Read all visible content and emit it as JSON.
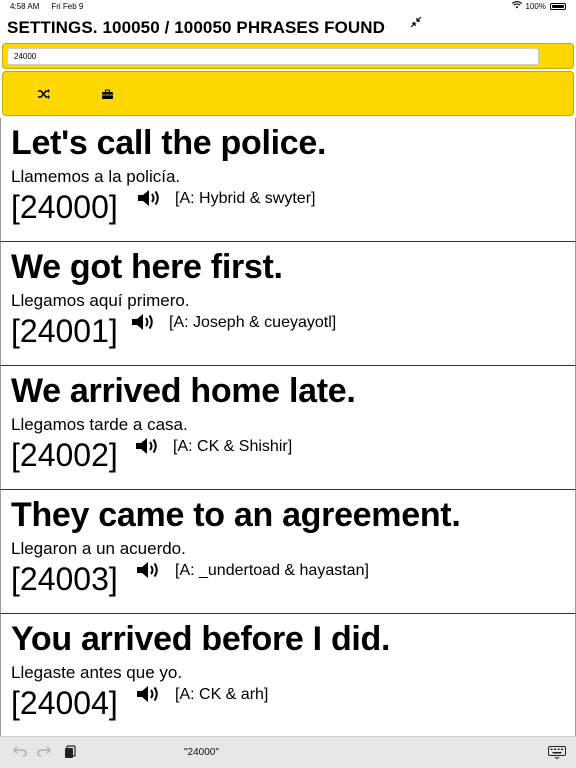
{
  "status": {
    "time": "4:58 AM",
    "date": "Fri Feb 9",
    "battery": "100%"
  },
  "header": {
    "title": "SETTINGS. 100050 / 100050 PHRASES FOUND"
  },
  "search": {
    "value": "24000"
  },
  "icons": {
    "collapse": "collapse-arrows-icon",
    "shuffle": "shuffle-icon",
    "briefcase": "briefcase-icon",
    "speaker": "speaker-icon",
    "undo": "undo-icon",
    "redo": "redo-icon",
    "paste": "paste-icon",
    "keyboard": "keyboard-icon"
  },
  "colors": {
    "toolbar": "#ffd700",
    "divider": "#333333"
  },
  "phrases": [
    {
      "english": "Let's call the police.",
      "spanish": "Llamemos a la policía.",
      "number": "[24000]",
      "attribution": "[A: Hybrid & swyter]"
    },
    {
      "english": "We got here first.",
      "spanish": "Llegamos aquí primero.",
      "number": "[24001]",
      "attribution": "[A: Joseph & cueyayotl]"
    },
    {
      "english": "We arrived home late.",
      "spanish": "Llegamos tarde a casa.",
      "number": "[24002]",
      "attribution": "[A: CK & Shishir]"
    },
    {
      "english": "They came to an agreement.",
      "spanish": "Llegaron a un acuerdo.",
      "number": "[24003]",
      "attribution": "[A: _undertoad & hayastan]"
    },
    {
      "english": "You arrived before I did.",
      "spanish": "Llegaste antes que yo.",
      "number": "[24004]",
      "attribution": "[A: CK & arh]"
    }
  ],
  "keyboard_bar": {
    "suggestion": "\"24000\""
  }
}
